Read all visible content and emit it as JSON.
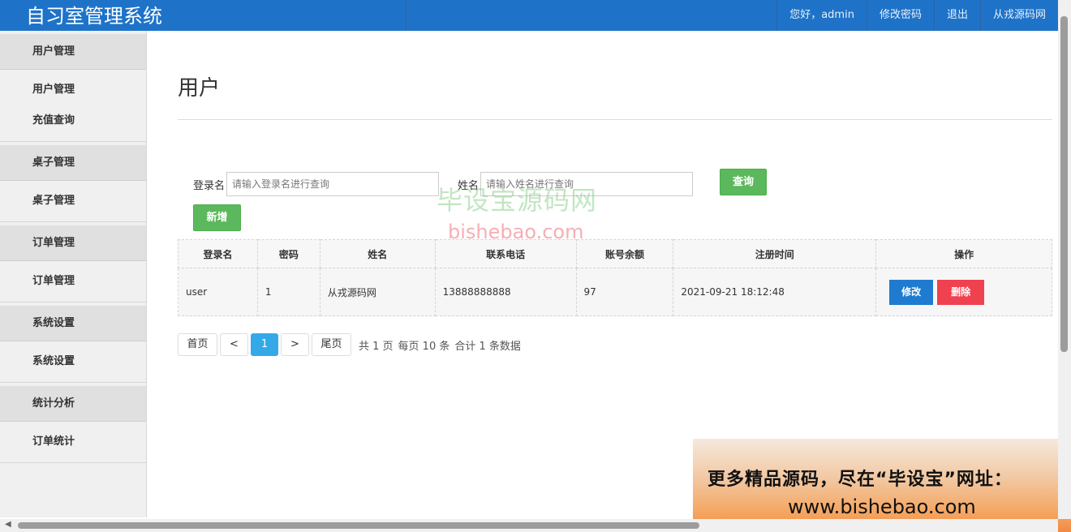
{
  "app": {
    "title": "自习室管理系统"
  },
  "topnav": [
    {
      "label": "您好，admin"
    },
    {
      "label": "修改密码"
    },
    {
      "label": "退出"
    },
    {
      "label": "从戎源码网"
    }
  ],
  "sidebar": {
    "groups": [
      {
        "title": "用户管理",
        "items": [
          "用户管理",
          "充值查询"
        ]
      },
      {
        "title": "桌子管理",
        "items": [
          "桌子管理"
        ]
      },
      {
        "title": "订单管理",
        "items": [
          "订单管理"
        ]
      },
      {
        "title": "系统设置",
        "items": [
          "系统设置"
        ]
      },
      {
        "title": "统计分析",
        "items": [
          "订单统计"
        ]
      }
    ]
  },
  "page": {
    "title": "用户"
  },
  "search": {
    "login_label": "登录名",
    "login_placeholder": "请输入登录名进行查询",
    "name_label": "姓名",
    "name_placeholder": "请输入姓名进行查询",
    "query_button": "查询",
    "add_button": "新增"
  },
  "table": {
    "headers": [
      "登录名",
      "密码",
      "姓名",
      "联系电话",
      "账号余额",
      "注册时间",
      "操作"
    ],
    "rows": [
      {
        "login": "user",
        "password": "1",
        "name": "从戎源码网",
        "phone": "13888888888",
        "balance": "97",
        "registered": "2021-09-21 18:12:48",
        "edit": "修改",
        "delete": "删除"
      }
    ]
  },
  "pagination": {
    "first": "首页",
    "prev": "<",
    "current": "1",
    "next": ">",
    "last": "尾页",
    "total_pages": "共 1 页",
    "per_page": "每页 10 条",
    "total_records": "合计 1 条数据"
  },
  "watermark": {
    "cn": "毕设宝源码网",
    "url": "bishebao.com"
  },
  "promo": {
    "line1": "更多精品源码，尽在“毕设宝”网址：",
    "line2": "www.bishebao.com"
  },
  "colors": {
    "topbar": "#1e73c8",
    "green": "#5cb85c",
    "edit": "#1f7bcf",
    "delete": "#f04150",
    "page_active": "#33a9e8"
  }
}
